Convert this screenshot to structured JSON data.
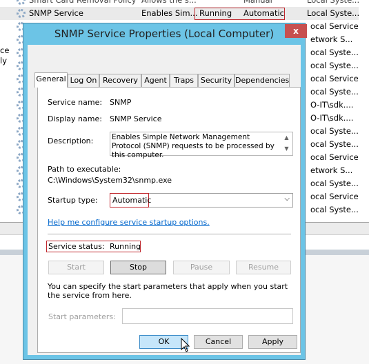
{
  "background": {
    "rows": [
      {
        "name": "Smart Card Removal Policy",
        "description": "Allows the s...",
        "status": "",
        "startup": "Manual",
        "logon": "Local Syste..."
      },
      {
        "name": "SNMP Service",
        "description": "Enables Sim...",
        "status": "Running",
        "startup": "Automatic",
        "logon": "Local Syste..."
      }
    ],
    "logon_column": [
      "ocal Service",
      "etwork S...",
      "ocal Syste...",
      "ocal Syste...",
      "ocal Service",
      "ocal Syste...",
      "O-IT\\sdk....",
      "O-IT\\sdk....",
      "ocal Syste...",
      "ocal Syste...",
      "ocal Service",
      "etwork S...",
      "ocal Syste...",
      "ocal Service",
      "ocal Syste..."
    ],
    "left_fragments": [
      "ce",
      "ly"
    ]
  },
  "dialog": {
    "title": "SNMP Service Properties (Local Computer)",
    "close_label": "x",
    "tabs": [
      "General",
      "Log On",
      "Recovery",
      "Agent",
      "Traps",
      "Security",
      "Dependencies"
    ],
    "active_tab": "General",
    "service_name_label": "Service name:",
    "service_name": "SNMP",
    "display_name_label": "Display name:",
    "display_name": "SNMP Service",
    "description_label": "Description:",
    "description": "Enables Simple Network Management Protocol (SNMP) requests to be processed by this computer.",
    "path_label": "Path to executable:",
    "path": "C:\\Windows\\System32\\snmp.exe",
    "startup_type_label": "Startup type:",
    "startup_type": "Automatic",
    "help_link": "Help me configure service startup options.",
    "status_label": "Service status:",
    "status": "Running",
    "buttons": {
      "start": "Start",
      "stop": "Stop",
      "pause": "Pause",
      "resume": "Resume"
    },
    "params_note": "You can specify the start parameters that apply when you start the service from here.",
    "params_label": "Start parameters:",
    "params_value": "",
    "ok": "OK",
    "cancel": "Cancel",
    "apply": "Apply"
  },
  "colors": {
    "frame": "#6cc4e6",
    "close": "#c75050",
    "highlight": "#c0272d",
    "link": "#0066cc"
  }
}
